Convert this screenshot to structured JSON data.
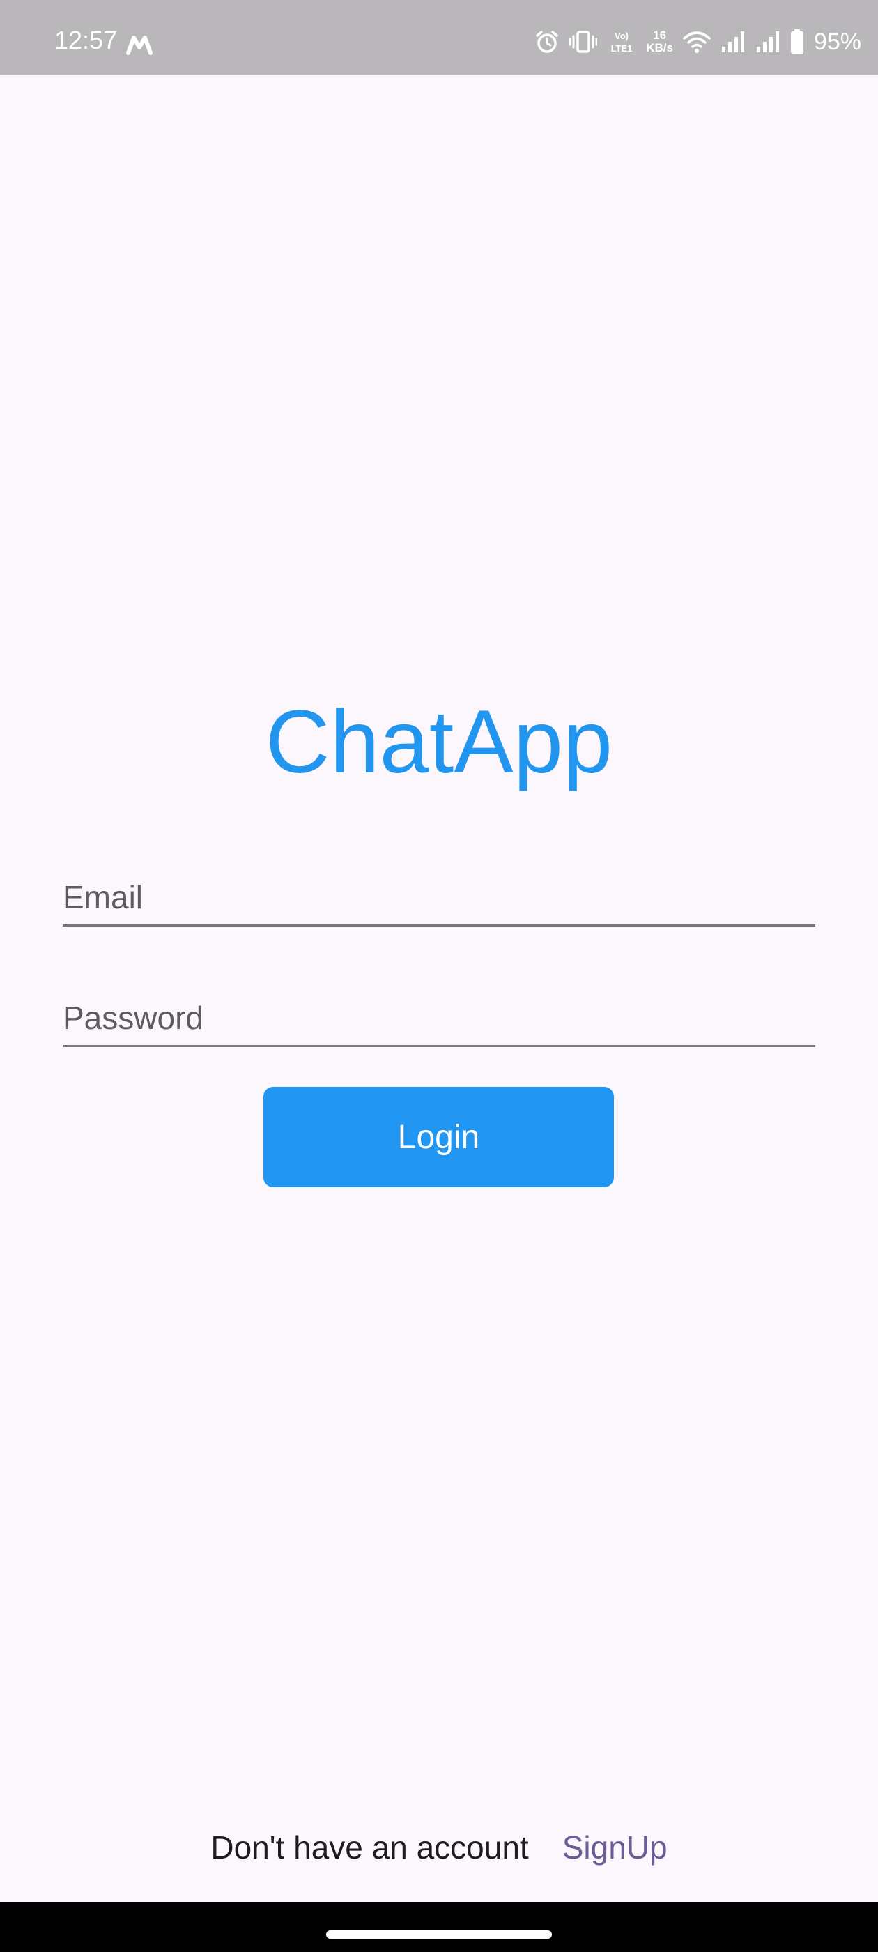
{
  "status_bar": {
    "time": "12:57",
    "speed_value": "16",
    "speed_unit": "KB/s",
    "volte_label": "Vo) LTE1",
    "battery_percent": "95%",
    "icons": [
      "m-app-icon",
      "alarm-icon",
      "vibrate-icon",
      "volte-icon",
      "network-speed",
      "wifi-icon",
      "signal-icon-1",
      "signal-icon-2",
      "battery-icon"
    ]
  },
  "app": {
    "title": "ChatApp"
  },
  "login_form": {
    "email_placeholder": "Email",
    "password_placeholder": "Password",
    "login_label": "Login"
  },
  "footer": {
    "prompt_text": "Don't have an account",
    "signup_label": "SignUp"
  },
  "colors": {
    "accent": "#2196f3",
    "title": "#2295ef",
    "link": "#6d5b95",
    "background": "#fcf6fd",
    "status_bar": "#bab7bb"
  }
}
